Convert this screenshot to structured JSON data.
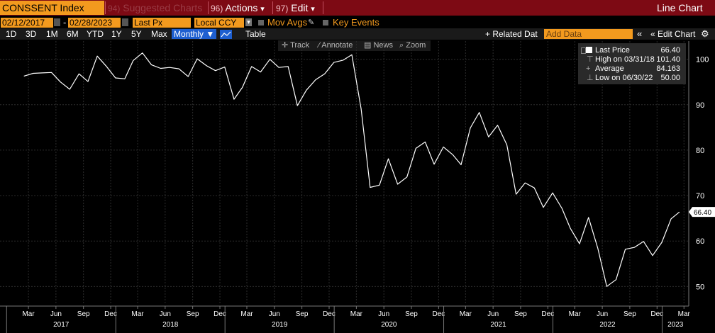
{
  "header": {
    "ticker": "CONSSENT Index",
    "suggested": {
      "num": "94)",
      "label": "Suggested Charts"
    },
    "actions": {
      "num": "96)",
      "label": "Actions",
      "arrow": "▾"
    },
    "edit": {
      "num": "97)",
      "label": "Edit",
      "arrow": "▾"
    },
    "chart_type": "Line Chart"
  },
  "options": {
    "start_date": "02/12/2017",
    "dash": "-",
    "end_date": "02/28/2023",
    "price_field": "Last Px",
    "currency": "Local CCY",
    "mov_avgs": "Mov Avgs",
    "key_events": "Key Events"
  },
  "periods": {
    "items": [
      "1D",
      "3D",
      "1M",
      "6M",
      "YTD",
      "1Y",
      "5Y",
      "Max"
    ],
    "frequency": "Monthly ▼",
    "table": "Table"
  },
  "toolbar": {
    "related": "+ Related Dat",
    "add_data_placeholder": "Add Data",
    "collapse": "«",
    "edit_chart": "« Edit Chart",
    "settings_icon": "gear-icon"
  },
  "chart_tools": {
    "track": "Track",
    "annotate": "Annotate",
    "news": "News",
    "zoom": "Zoom"
  },
  "legend": {
    "last_label": "Last Price",
    "last_value": "66.40",
    "high_label": "High on 03/31/18",
    "high_value": "101.40",
    "avg_label": "Average",
    "avg_value": "84.163",
    "low_label": "Low on 06/30/22",
    "low_value": "50.00"
  },
  "colors": {
    "header_bg": "#7d0a14",
    "accent": "#f39a1e",
    "line": "#ffffff",
    "grid": "#2c2c2c",
    "selected": "#1e5fd0"
  },
  "chart_data": {
    "type": "line",
    "series": [
      {
        "name": "Last Price",
        "x": [
          "2017-02",
          "2017-03",
          "2017-04",
          "2017-05",
          "2017-06",
          "2017-07",
          "2017-08",
          "2017-09",
          "2017-10",
          "2017-11",
          "2017-12",
          "2018-01",
          "2018-02",
          "2018-03",
          "2018-04",
          "2018-05",
          "2018-06",
          "2018-07",
          "2018-08",
          "2018-09",
          "2018-10",
          "2018-11",
          "2018-12",
          "2019-01",
          "2019-02",
          "2019-03",
          "2019-04",
          "2019-05",
          "2019-06",
          "2019-07",
          "2019-08",
          "2019-09",
          "2019-10",
          "2019-11",
          "2019-12",
          "2020-01",
          "2020-02",
          "2020-03",
          "2020-04",
          "2020-05",
          "2020-06",
          "2020-07",
          "2020-08",
          "2020-09",
          "2020-10",
          "2020-11",
          "2020-12",
          "2021-01",
          "2021-02",
          "2021-03",
          "2021-04",
          "2021-05",
          "2021-06",
          "2021-07",
          "2021-08",
          "2021-09",
          "2021-10",
          "2021-11",
          "2021-12",
          "2022-01",
          "2022-02",
          "2022-03",
          "2022-04",
          "2022-05",
          "2022-06",
          "2022-07",
          "2022-08",
          "2022-09",
          "2022-10",
          "2022-11",
          "2022-12",
          "2023-01",
          "2023-02"
        ],
        "values": [
          96.3,
          96.9,
          97.0,
          97.1,
          95.0,
          93.4,
          96.8,
          95.1,
          100.7,
          98.5,
          95.9,
          95.7,
          99.7,
          101.4,
          98.8,
          98.0,
          98.2,
          97.9,
          96.2,
          100.1,
          98.6,
          97.5,
          98.3,
          91.2,
          93.8,
          98.4,
          97.2,
          100.0,
          98.2,
          98.4,
          89.8,
          93.2,
          95.5,
          96.8,
          99.3,
          99.8,
          101.0,
          89.1,
          71.8,
          72.3,
          78.1,
          72.5,
          74.1,
          80.4,
          81.8,
          76.9,
          80.7,
          79.0,
          76.8,
          84.9,
          88.3,
          82.9,
          85.5,
          81.2,
          70.3,
          72.8,
          71.7,
          67.4,
          70.6,
          67.2,
          62.8,
          59.4,
          65.2,
          58.4,
          50.0,
          51.5,
          58.2,
          58.6,
          59.9,
          56.8,
          59.7,
          64.9,
          66.4
        ]
      }
    ],
    "ylim": [
      46,
      104
    ],
    "yticks": [
      50,
      60,
      70,
      80,
      90,
      100
    ],
    "xlim": [
      "2016-12-10",
      "2023-03-31"
    ],
    "month_ticks": [
      "Mar",
      "Jun",
      "Sep",
      "Dec",
      "Mar",
      "Jun",
      "Sep",
      "Dec",
      "Mar",
      "Jun",
      "Sep",
      "Dec",
      "Mar",
      "Jun",
      "Sep",
      "Dec",
      "Mar",
      "Jun",
      "Sep",
      "Dec",
      "Mar",
      "Jun",
      "Sep",
      "Dec",
      "Mar"
    ],
    "year_labels": [
      "2017",
      "2018",
      "2019",
      "2020",
      "2021",
      "2022",
      "2023"
    ],
    "last_value_label": "66.40",
    "grid": true
  }
}
